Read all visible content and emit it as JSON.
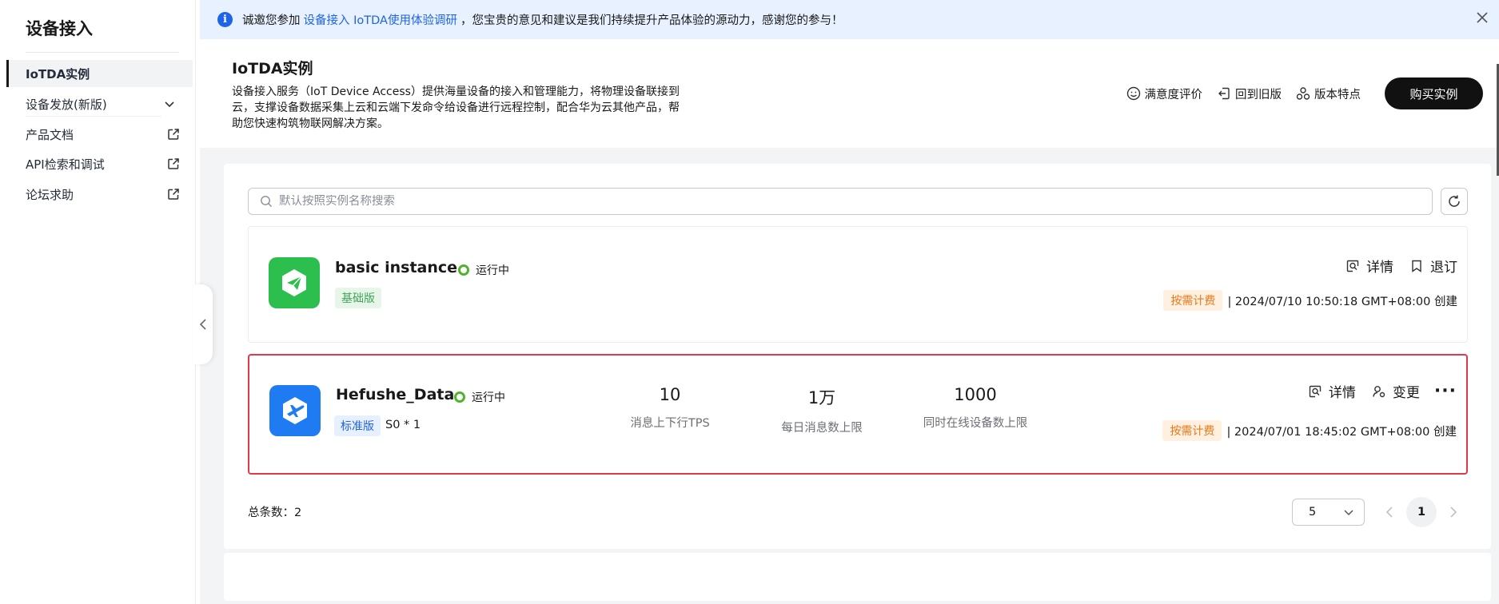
{
  "sidebar": {
    "title": "设备接入",
    "items": [
      {
        "label": "IoTDA实例"
      },
      {
        "label": "设备发放(新版)"
      },
      {
        "label": "产品文档"
      },
      {
        "label": "API检索和调试"
      },
      {
        "label": "论坛求助"
      }
    ]
  },
  "notice": {
    "prefix": "诚邀您参加",
    "link": "设备接入 IoTDA使用体验调研",
    "suffix": "，您宝贵的意见和建议是我们持续提升产品体验的源动力，感谢您的参与！"
  },
  "header": {
    "title": "IoTDA实例",
    "description": "设备接入服务（IoT Device Access）提供海量设备的接入和管理能力，将物理设备联接到云，支撑设备数据采集上云和云端下发命令给设备进行远程控制，配合华为云其他产品，帮助您快速构筑物联网解决方案。",
    "actions": {
      "satisfaction": "满意度评价",
      "old_version": "回到旧版",
      "features": "版本特点",
      "buy": "购买实例"
    }
  },
  "search": {
    "placeholder": "默认按照实例名称搜索"
  },
  "instances": [
    {
      "name": "basic instance",
      "status": "运行中",
      "edition": "基础版",
      "ops": [
        "详情",
        "退订"
      ],
      "billing": "按需计费",
      "created": "| 2024/07/10 10:50:18 GMT+08:00 创建"
    },
    {
      "name": "Hefushe_Data",
      "status": "运行中",
      "edition": "标准版",
      "spec": "S0 * 1",
      "metrics": [
        {
          "value": "10",
          "label": "消息上下行TPS"
        },
        {
          "value": "1万",
          "label": "每日消息数上限"
        },
        {
          "value": "1000",
          "label": "同时在线设备数上限"
        }
      ],
      "ops": [
        "详情",
        "变更"
      ],
      "more": "···",
      "billing": "按需计费",
      "created": "| 2024/07/01 18:45:02 GMT+08:00 创建"
    }
  ],
  "pagination": {
    "total": "总条数：2",
    "page_size": "5",
    "current_page": "1"
  },
  "colors": {
    "accent_blue": "#1f64e8",
    "status_green": "#50b32a",
    "selected_border": "#e0394a",
    "billing_orange": "#e8791b"
  }
}
